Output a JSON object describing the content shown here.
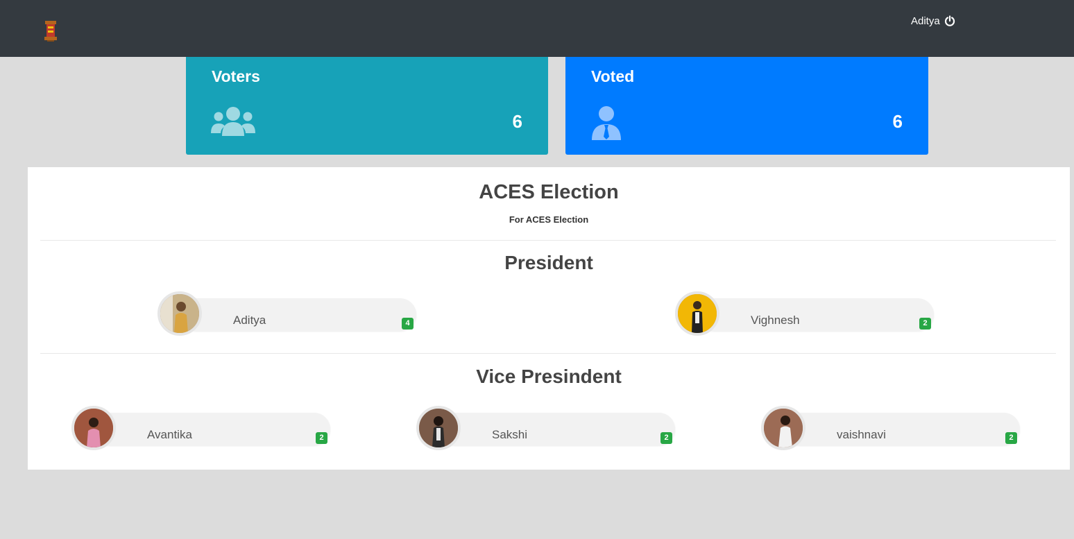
{
  "header": {
    "logo_icon": "college-emblem-icon",
    "user_name": "Aditya",
    "logout_icon": "power-icon"
  },
  "stats": {
    "voters": {
      "label": "Voters",
      "count": "6",
      "icon": "users-icon",
      "color": "#17a2b8"
    },
    "voted": {
      "label": "Voted",
      "count": "6",
      "icon": "user-tie-icon",
      "color": "#007bff"
    }
  },
  "election": {
    "title": "ACES Election",
    "description": "For ACES Election"
  },
  "positions": [
    {
      "title": "President",
      "candidates": [
        {
          "name": "Aditya",
          "votes": "4"
        },
        {
          "name": "Vighnesh",
          "votes": "2"
        }
      ]
    },
    {
      "title": "Vice Presindent",
      "candidates": [
        {
          "name": "Avantika",
          "votes": "2"
        },
        {
          "name": "Sakshi",
          "votes": "2"
        },
        {
          "name": "vaishnavi",
          "votes": "2"
        }
      ]
    }
  ],
  "colors": {
    "topbar": "#343a40",
    "vote_badge": "#28a745",
    "background": "#dcdcdc"
  }
}
